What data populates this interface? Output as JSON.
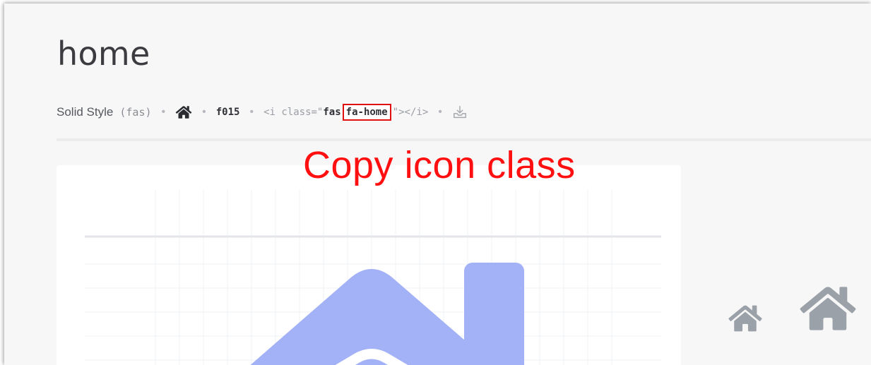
{
  "page": {
    "title": "home"
  },
  "meta": {
    "style_label": "Solid Style",
    "style_prefix_open": "(",
    "style_prefix": "fas",
    "style_prefix_close": ")",
    "separator": "•",
    "unicode": "f015",
    "snippet": {
      "open": "<i class=\"",
      "prefix": "fas",
      "class_name": "fa-home",
      "close": "\"></i>"
    }
  },
  "annotation": {
    "text": "Copy icon class",
    "color": "#ff0f0f"
  },
  "icons": {
    "home": "home-icon",
    "download": "download-icon"
  },
  "colors": {
    "preview_icon": "#a3b1f6",
    "icon_gray": "#9ba1a8",
    "highlight_border": "#e01010"
  }
}
